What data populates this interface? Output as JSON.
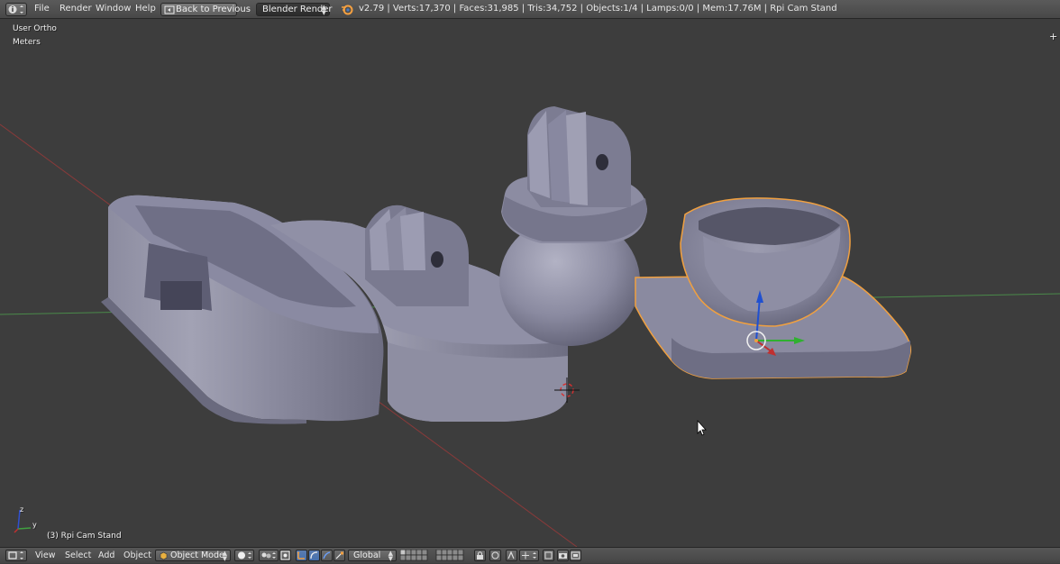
{
  "info_header": {
    "menu": [
      "File",
      "Render",
      "Window",
      "Help"
    ],
    "back_button": "Back to Previous",
    "render_engine": "Blender Render",
    "stats": "v2.79 | Verts:17,370 | Faces:31,985 | Tris:34,752 | Objects:1/4 | Lamps:0/0 | Mem:17.76M | Rpi Cam Stand"
  },
  "viewport": {
    "view_name": "User Ortho",
    "units": "Meters",
    "object_info": "(3) Rpi Cam Stand",
    "axis_labels": {
      "z": "z",
      "y": "y"
    }
  },
  "view3d_header": {
    "menu": [
      "View",
      "Select",
      "Add",
      "Object"
    ],
    "mode": "Object Mode",
    "orientation": "Global"
  },
  "icons": [
    "info-editor-icon",
    "blender-logo-icon",
    "back-icon",
    "camera-icon",
    "object-mode-icon",
    "viewport-shading-icon",
    "pivot-icon",
    "manipulator-icon",
    "translate-icon",
    "rotate-icon",
    "scale-icon",
    "layers-icon",
    "lock-icon",
    "snap-icon",
    "render-icon",
    "opengl-render-icon"
  ],
  "colors": {
    "selection_outline": "#f0a040",
    "x_axis": "#a83a3a",
    "y_axis": "#4aa04a",
    "z_axis": "#2050d0",
    "mesh": "#8a8aa0"
  }
}
